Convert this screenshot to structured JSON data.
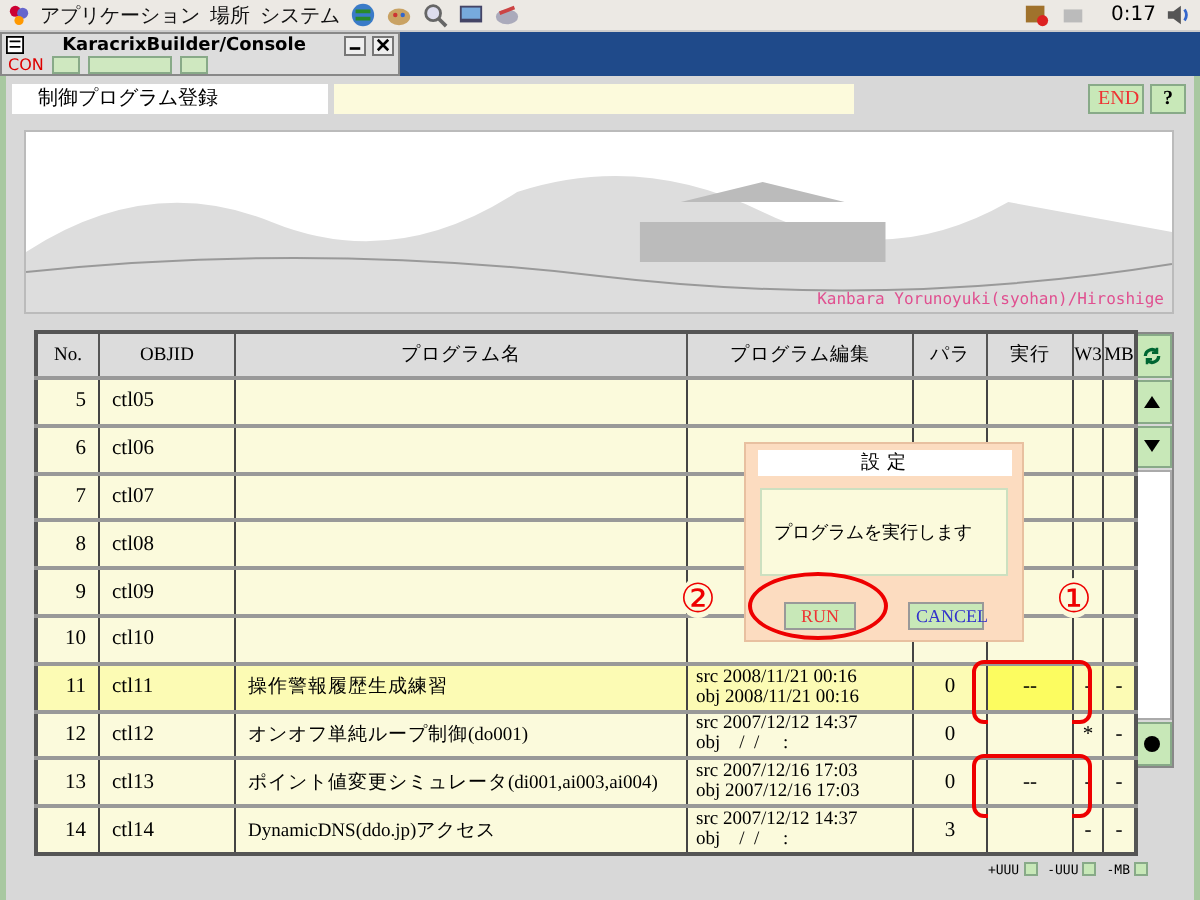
{
  "top_panel": {
    "menus": [
      "アプリケーション",
      "場所",
      "システム"
    ],
    "clock": "0:17"
  },
  "console_window": {
    "title": "KaracrixBuilder/Console",
    "toolbar_label": "CON"
  },
  "app": {
    "title": "制御プログラム登録",
    "buttons": [
      {
        "label": "END",
        "kind": "end"
      },
      {
        "label": "?",
        "kind": "help"
      }
    ],
    "banner": {
      "caption": "Kanbara Yorunoyuki(syohan)/Hiroshige"
    },
    "table": {
      "columns": [
        "No.",
        "OBJID",
        "プログラム名",
        "プログラム編集",
        "パラ",
        "実行",
        "W3",
        "MB"
      ],
      "rows": [
        {
          "no": "5",
          "objid": "ctl05",
          "selected": false,
          "annotated": false
        },
        {
          "no": "6",
          "objid": "ctl06",
          "selected": false,
          "annotated": false
        },
        {
          "no": "7",
          "objid": "ctl07",
          "selected": false,
          "annotated": false
        },
        {
          "no": "8",
          "objid": "ctl08",
          "selected": false,
          "annotated": false
        },
        {
          "no": "9",
          "objid": "ctl09",
          "selected": false,
          "annotated": false
        },
        {
          "no": "10",
          "objid": "ctl10",
          "selected": false,
          "annotated": false
        },
        {
          "no": "11",
          "objid": "ctl11",
          "name": "操作警報履歴生成練習",
          "edit": [
            {
              "label": "src",
              "date": "2008/11/21 00:16"
            },
            {
              "label": "obj",
              "date": "2008/11/21 00:16"
            }
          ],
          "para": "0",
          "exec": "--",
          "w3": "-",
          "mb": "-",
          "selected": true,
          "annotated": true
        },
        {
          "no": "12",
          "objid": "ctl12",
          "name": "オンオフ単純ループ制御(do001)",
          "edit": [
            {
              "label": "src",
              "date": "2007/12/12 14:37"
            },
            {
              "label": "obj",
              "date": "   /  /     :"
            }
          ],
          "para": "0",
          "w3": "*",
          "mb": "-",
          "selected": false,
          "annotated": false
        },
        {
          "no": "13",
          "objid": "ctl13",
          "name": "ポイント値変更シミュレータ(di001,ai003,ai004)",
          "edit": [
            {
              "label": "src",
              "date": "2007/12/16 17:03"
            },
            {
              "label": "obj",
              "date": "2007/12/16 17:03"
            }
          ],
          "para": "0",
          "exec": "--",
          "w3": "-",
          "mb": "-",
          "selected": false,
          "annotated": true
        },
        {
          "no": "14",
          "objid": "ctl14",
          "name": "DynamicDNS(ddo.jp)アクセス",
          "edit": [
            {
              "label": "src",
              "date": "2007/12/12 14:37"
            },
            {
              "label": "obj",
              "date": "   /  /     :"
            }
          ],
          "para": "3",
          "w3": "-",
          "mb": "-",
          "selected": false,
          "annotated": false
        }
      ]
    },
    "scroll_buttons": [
      {
        "kind": "refresh"
      },
      {
        "kind": "up"
      },
      {
        "kind": "down"
      },
      {
        "kind": "track"
      },
      {
        "kind": "dot"
      }
    ],
    "dialog": {
      "title": "設 定",
      "message": "プログラムを実行します",
      "buttons": [
        {
          "label": "RUN",
          "kind": "run",
          "annotated": true
        },
        {
          "label": "CANCEL",
          "kind": "cancel",
          "annotated": false
        }
      ]
    },
    "annotations": [
      {
        "label": "②",
        "kind": "left"
      },
      {
        "label": "①",
        "kind": "right"
      }
    ],
    "footer_buttons": [
      "+UUU",
      "-UUU",
      "-MB"
    ]
  }
}
